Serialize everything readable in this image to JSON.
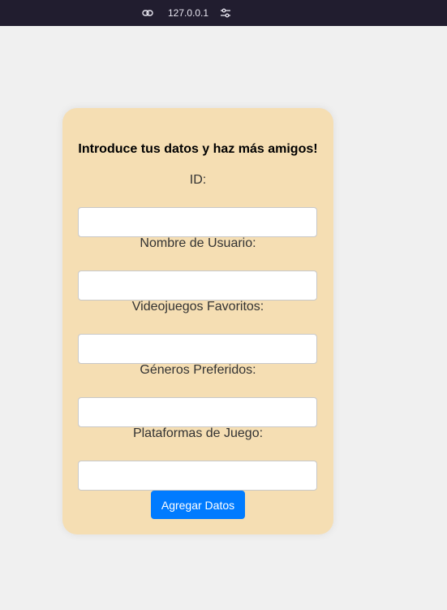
{
  "browser": {
    "url": "127.0.0.1",
    "link_icon": "link-icon",
    "settings_icon": "tune-icon"
  },
  "form": {
    "title": "Introduce tus datos y haz más amigos!",
    "fields": [
      {
        "label": "ID:",
        "value": "",
        "placeholder": ""
      },
      {
        "label": "Nombre de Usuario:",
        "value": "",
        "placeholder": ""
      },
      {
        "label": "Videojuegos Favoritos:",
        "value": "",
        "placeholder": ""
      },
      {
        "label": "Géneros Preferidos:",
        "value": "",
        "placeholder": ""
      },
      {
        "label": "Plataformas de Juego:",
        "value": "",
        "placeholder": ""
      }
    ],
    "submit_label": "Agregar Datos"
  },
  "colors": {
    "page_background": "#f0f0f0",
    "topbar": "#211d2f",
    "card": "#f5deb3",
    "button": "#007bff"
  }
}
